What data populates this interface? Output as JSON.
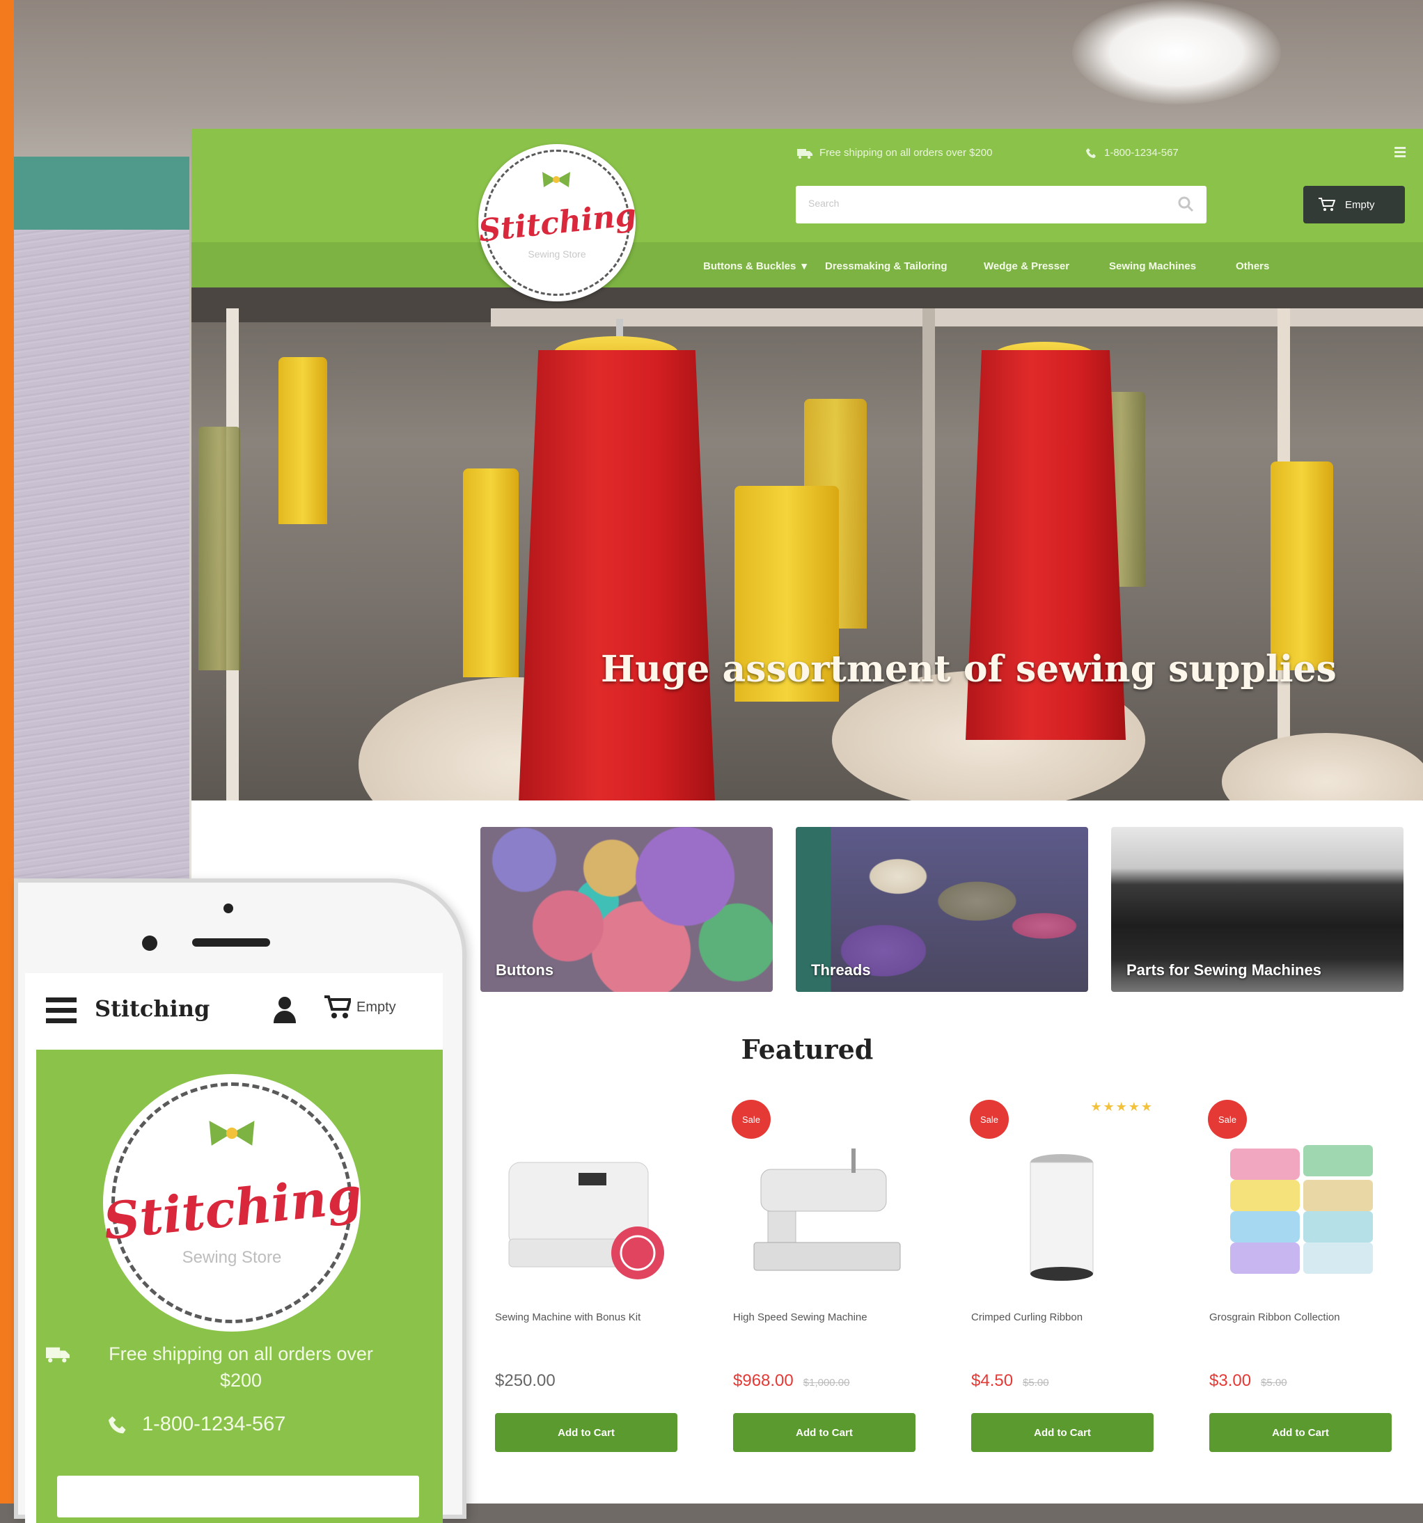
{
  "brand": {
    "name": "Stitching",
    "tagline": "Sewing Store",
    "colors": {
      "green": "#8bc34a",
      "dark_green": "#5a9a2e",
      "red": "#d9283c",
      "cart_bg": "#333b36"
    }
  },
  "desktop": {
    "top_bar": {
      "shipping_text": "Free shipping on all orders over $200",
      "phone_text": "1-800-1234-567",
      "menu_icon": "list-icon"
    },
    "search": {
      "placeholder": "Search"
    },
    "cart": {
      "label": "Empty"
    },
    "nav": [
      {
        "label": "Buttons & Buckles"
      },
      {
        "label": "Dressmaking & Tailoring"
      },
      {
        "label": "Wedge & Presser"
      },
      {
        "label": "Sewing Machines"
      },
      {
        "label": "Others"
      }
    ],
    "hero": {
      "title": "Huge assortment of sewing supplies",
      "slides": 3,
      "active_slide": 1
    },
    "categories": [
      {
        "label": "Buttons"
      },
      {
        "label": "Threads"
      },
      {
        "label": "Parts for Sewing Machines"
      }
    ],
    "featured": {
      "title": "Featured",
      "products": [
        {
          "name": "Sewing Machine with Bonus Kit",
          "price": "$250.00",
          "old_price": "",
          "badge": "",
          "button": "Add to Cart"
        },
        {
          "name": "High Speed Sewing Machine",
          "price": "$968.00",
          "old_price": "$1,000.00",
          "badge": "Sale",
          "button": "Add to Cart"
        },
        {
          "name": "Crimped Curling Ribbon",
          "price": "$4.50",
          "old_price": "$5.00",
          "badge": "Sale",
          "button": "Add to Cart",
          "stars": "★★★★★"
        },
        {
          "name": "Grosgrain Ribbon Collection",
          "price": "$3.00",
          "old_price": "$5.00",
          "badge": "Sale",
          "button": "Add to Cart"
        }
      ]
    }
  },
  "mobile": {
    "title": "Stitching",
    "cart_label": "Empty",
    "shipping_text": "Free shipping on all orders over $200",
    "phone_text": "1-800-1234-567"
  }
}
